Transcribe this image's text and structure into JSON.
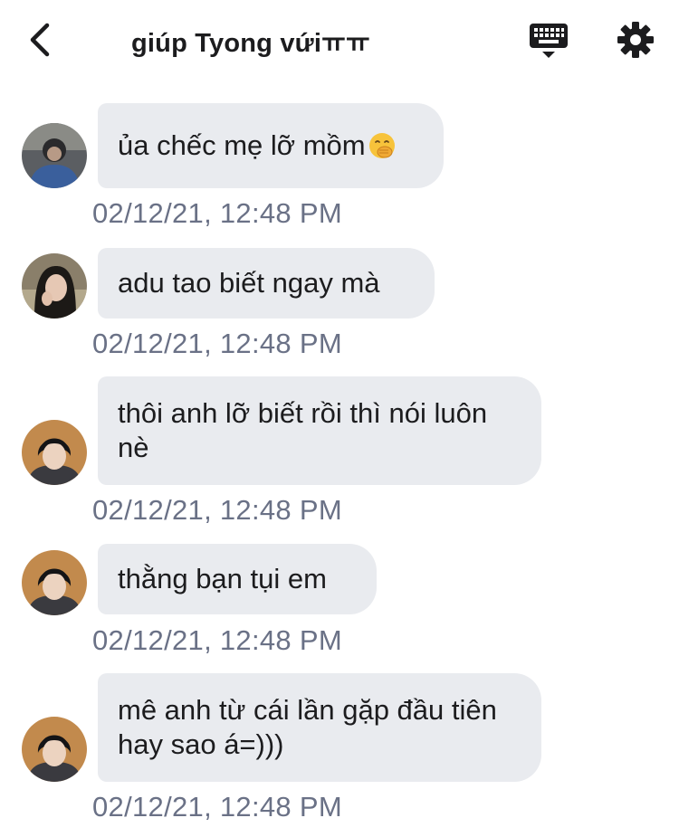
{
  "header": {
    "title": "giúp Tyong vứiㅠㅠ",
    "back_icon": "chevron-left-icon",
    "keyboard_icon": "keyboard-icon",
    "settings_icon": "gear-icon"
  },
  "colors": {
    "bubble_bg": "#e9ebef",
    "timestamp": "#6a7186",
    "text": "#1c1c1e"
  },
  "messages": [
    {
      "text": "ủa chếc mẹ lỡ mồm",
      "emoji": "face-with-hand-over-mouth",
      "timestamp": "02/12/21, 12:48 PM"
    },
    {
      "text": "adu tao biết ngay mà",
      "timestamp": "02/12/21, 12:48 PM"
    },
    {
      "text": "thôi anh lỡ biết rồi thì nói luôn nè",
      "timestamp": "02/12/21, 12:48 PM"
    },
    {
      "text": "thằng bạn tụi em",
      "timestamp": "02/12/21, 12:48 PM"
    },
    {
      "text": "mê anh từ cái lần gặp đầu tiên hay sao á=)))",
      "timestamp": "02/12/21, 12:48 PM"
    }
  ]
}
